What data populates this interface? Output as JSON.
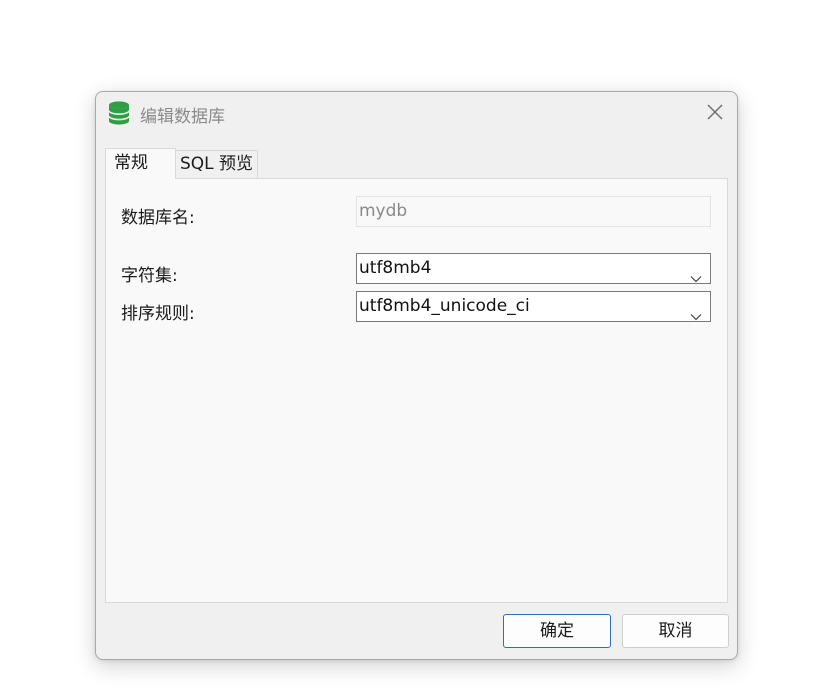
{
  "window": {
    "title": "编辑数据库",
    "icon": "database-icon",
    "accent_color": "#2f9e44"
  },
  "tabs": [
    {
      "label": "常规",
      "active": true
    },
    {
      "label": "SQL 预览",
      "active": false
    }
  ],
  "form": {
    "name_label": "数据库名:",
    "name_value": "mydb",
    "charset_label": "字符集:",
    "charset_value": "utf8mb4",
    "collation_label": "排序规则:",
    "collation_value": "utf8mb4_unicode_ci"
  },
  "buttons": {
    "ok": "确定",
    "cancel": "取消"
  }
}
